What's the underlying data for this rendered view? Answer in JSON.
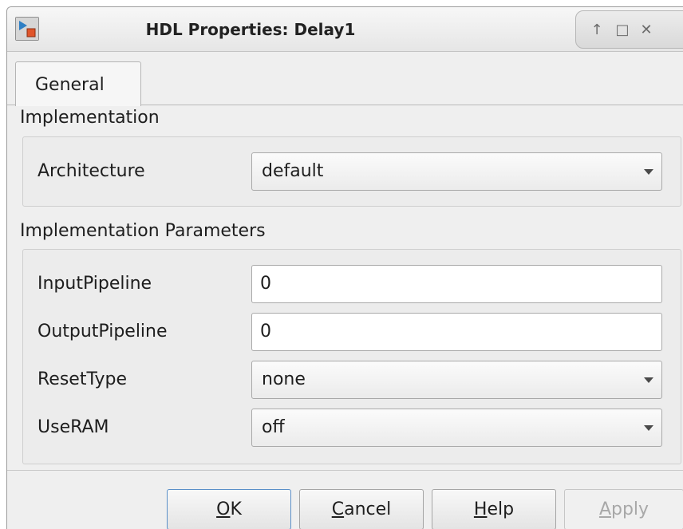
{
  "window": {
    "title": "HDL Properties: Delay1",
    "controls": [
      "↑",
      "□",
      "✕"
    ]
  },
  "tabs": [
    {
      "label": "General",
      "selected": true
    }
  ],
  "implementation": {
    "heading": "Implementation",
    "architecture": {
      "label": "Architecture",
      "value": "default"
    }
  },
  "parameters": {
    "heading": "Implementation Parameters",
    "fields": [
      {
        "label": "InputPipeline",
        "type": "text",
        "value": "0"
      },
      {
        "label": "OutputPipeline",
        "type": "text",
        "value": "0"
      },
      {
        "label": "ResetType",
        "type": "combo",
        "value": "none"
      },
      {
        "label": "UseRAM",
        "type": "combo",
        "value": "off"
      }
    ]
  },
  "buttons": {
    "ok": {
      "mnemonic": "O",
      "rest": "K"
    },
    "cancel": {
      "mnemonic": "C",
      "rest": "ancel"
    },
    "help": {
      "mnemonic": "H",
      "rest": "elp"
    },
    "apply": {
      "mnemonic": "A",
      "rest": "pply",
      "disabled": true
    }
  },
  "colors": {
    "accent": "#5a8fc8",
    "window_bg": "#efefef"
  },
  "icons": {
    "app": "simulink-block-icon",
    "minimize": "up-arrow-icon",
    "maximize": "maximize-icon",
    "close": "close-icon"
  }
}
